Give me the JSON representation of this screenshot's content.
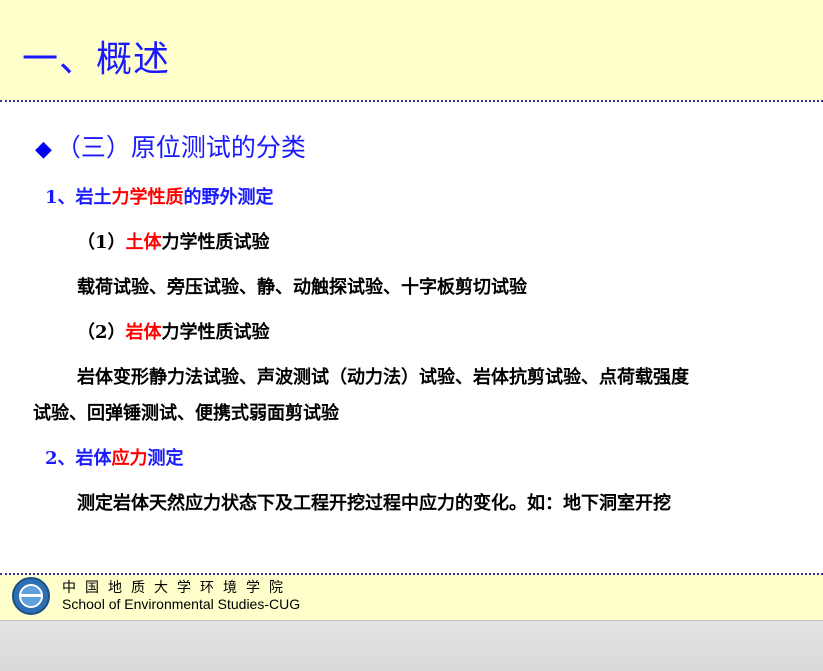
{
  "header": {
    "title": "一、概述"
  },
  "section": {
    "bullet": "◆",
    "heading": "（三）原位测试的分类"
  },
  "content": {
    "item1": {
      "prefix": "1、岩土",
      "highlight": "力学性质",
      "suffix": "的野外测定"
    },
    "sub1": {
      "prefix": "（1）",
      "highlight": "土体",
      "suffix": "力学性质试验"
    },
    "sub1_text": "载荷试验、旁压试验、静、动触探试验、十字板剪切试验",
    "sub2": {
      "prefix": "（2）",
      "highlight": "岩体",
      "suffix": "力学性质试验"
    },
    "sub2_text_line1": "岩体变形静力法试验、声波测试（动力法）试验、岩体抗剪试验、点荷载强度",
    "sub2_text_line2": "试验、回弹锤测试、便携式弱面剪试验",
    "item2": {
      "prefix": "2、岩体",
      "highlight": "应力",
      "suffix": "测定"
    },
    "item2_text": "测定岩体天然应力状态下及工程开挖过程中应力的变化。如：地下洞室开挖"
  },
  "footer": {
    "cn": "中国地质大学环境学院",
    "en": "School of Environmental Studies-CUG",
    "logo": "university-seal-icon"
  },
  "colors": {
    "title": "#1a1aff",
    "highlight": "#ff0000",
    "background_band": "#ffffcc"
  }
}
